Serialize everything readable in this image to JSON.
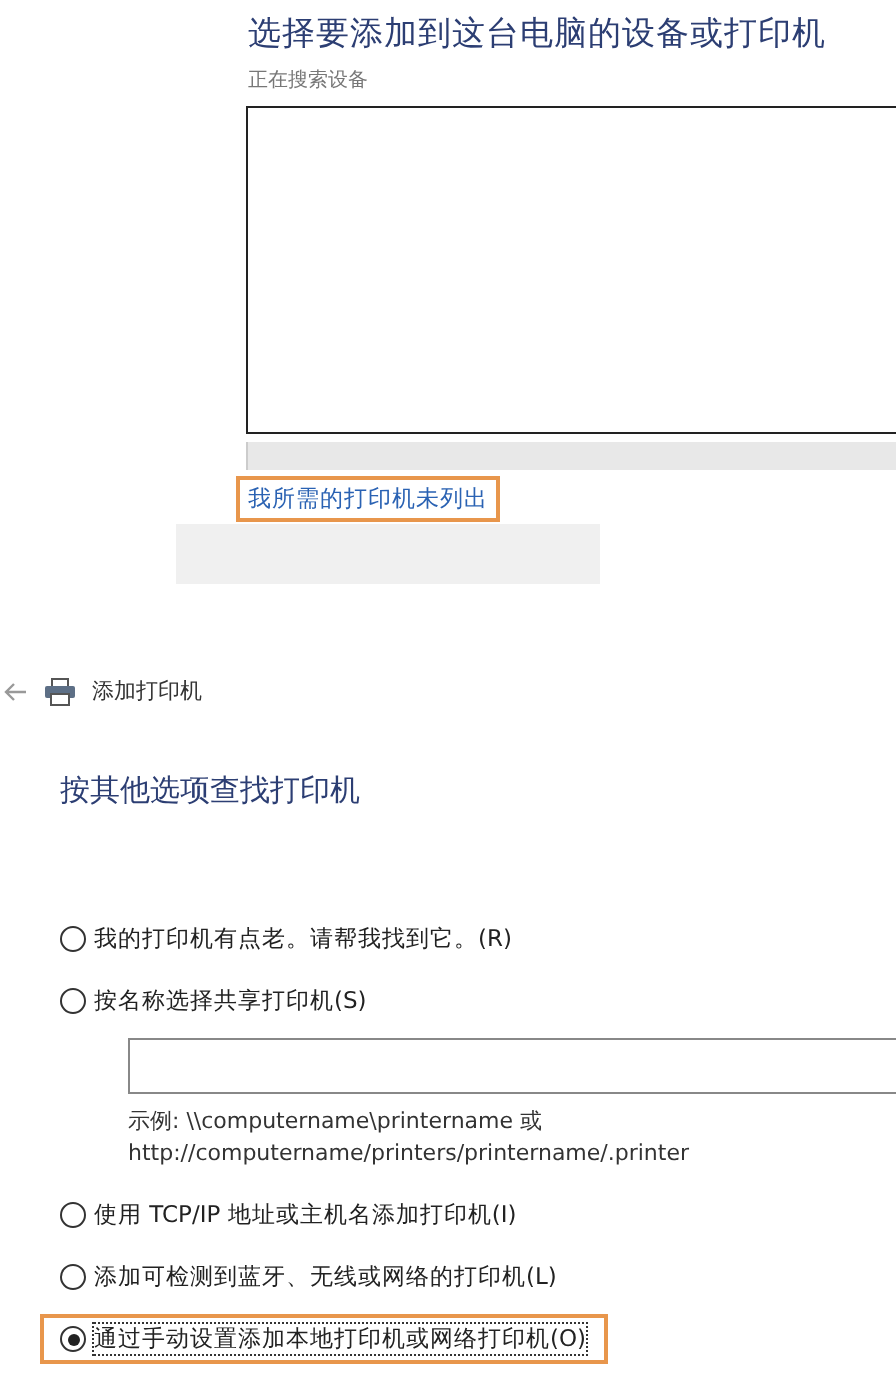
{
  "device_picker": {
    "title": "选择要添加到这台电脑的设备或打印机",
    "status": "正在搜索设备",
    "link": {
      "label": "我所需的打印机未列出",
      "highlighted": true
    }
  },
  "add_printer": {
    "title": "添加打印机",
    "heading": "按其他选项查找打印机",
    "options": [
      {
        "kind": "radio",
        "label": "我的打印机有点老。请帮我找到它。(R)",
        "selected": false,
        "highlighted": false
      },
      {
        "kind": "radio",
        "label": "按名称选择共享打印机(S)",
        "selected": false,
        "highlighted": false
      },
      {
        "kind": "field",
        "example": [
          "示例: \\\\computername\\printername 或",
          "http://computername/printers/printername/.printer"
        ]
      },
      {
        "kind": "radio",
        "label": "使用 TCP/IP 地址或主机名添加打印机(I)",
        "selected": false,
        "highlighted": false
      },
      {
        "kind": "radio",
        "label": "添加可检测到蓝牙、无线或网络的打印机(L)",
        "selected": false,
        "highlighted": false
      },
      {
        "kind": "radio",
        "label": "通过手动设置添加本地打印机或网络打印机(O)",
        "selected": true,
        "highlighted": true
      }
    ]
  }
}
